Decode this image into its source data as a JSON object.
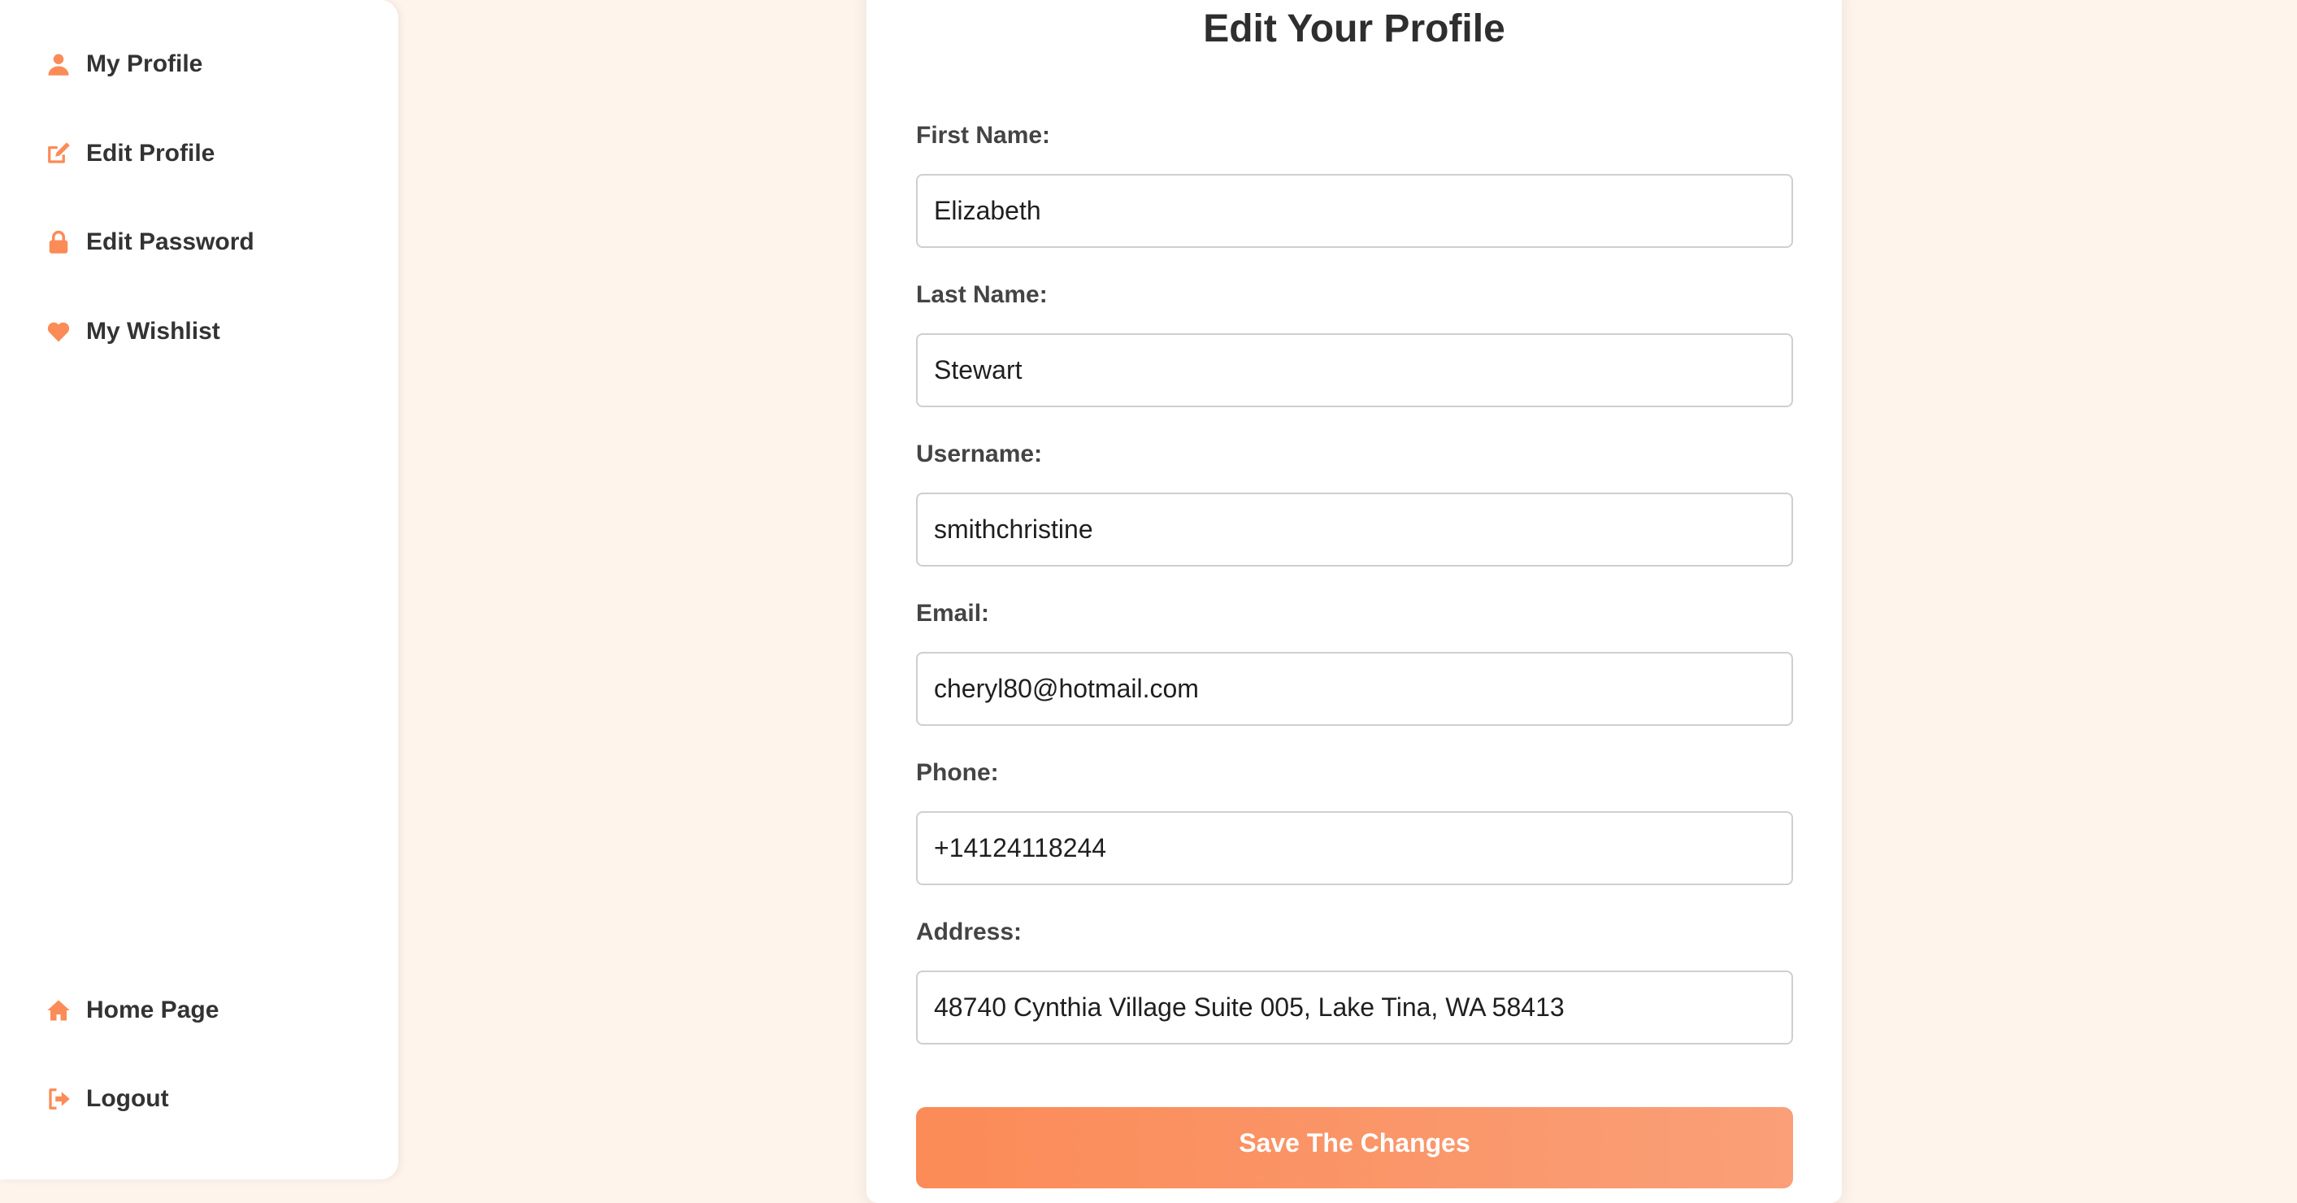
{
  "accent_color": "#fb8b57",
  "sidebar": {
    "items": [
      {
        "label": "My Profile",
        "icon": "user-icon"
      },
      {
        "label": "Edit Profile",
        "icon": "edit-icon"
      },
      {
        "label": "Edit Password",
        "icon": "lock-icon"
      },
      {
        "label": "My Wishlist",
        "icon": "heart-icon"
      }
    ],
    "bottom_items": [
      {
        "label": "Home Page",
        "icon": "home-icon"
      },
      {
        "label": "Logout",
        "icon": "logout-icon"
      }
    ]
  },
  "form": {
    "title": "Edit Your Profile",
    "fields": [
      {
        "label": "First Name:",
        "value": "Elizabeth"
      },
      {
        "label": "Last Name:",
        "value": "Stewart"
      },
      {
        "label": "Username:",
        "value": "smithchristine"
      },
      {
        "label": "Email:",
        "value": "cheryl80@hotmail.com"
      },
      {
        "label": "Phone:",
        "value": "+14124118244"
      },
      {
        "label": "Address:",
        "value": "48740 Cynthia Village Suite 005, Lake Tina, WA 58413"
      }
    ],
    "submit_label": "Save The Changes"
  }
}
